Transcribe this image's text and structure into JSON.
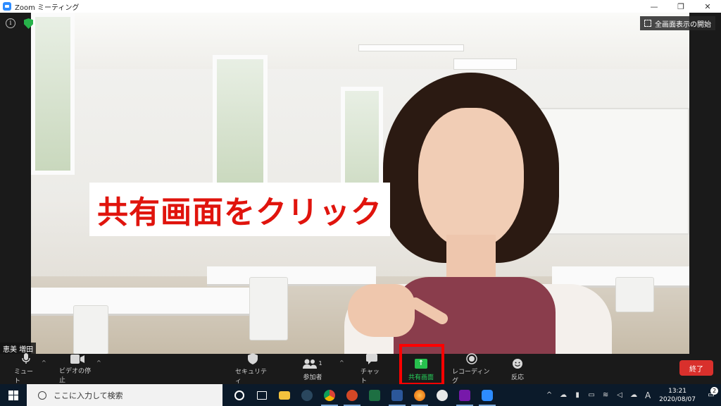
{
  "window": {
    "title": "Zoom ミーティング",
    "minimize_label": "—",
    "restore_label": "❐",
    "close_label": "✕"
  },
  "meeting": {
    "info_label": "i",
    "fullscreen_label": "全画面表示の開始",
    "participant_name": "恵美 増田",
    "caption": "共有画面をクリック"
  },
  "toolbar": {
    "mute_label": "ミュート",
    "video_label": "ビデオの停止",
    "security_label": "セキュリティ",
    "participants_label": "参加者",
    "participants_count": "1",
    "chat_label": "チャット",
    "share_label": "共有画面",
    "record_label": "レコーディング",
    "reactions_label": "反応",
    "end_label": "終了"
  },
  "taskbar": {
    "search_placeholder": "ここに入力して検索",
    "time": "13:21",
    "date": "2020/08/07",
    "ime_label": "A",
    "notification_count": "2",
    "apps": [
      "task-view",
      "file-explorer",
      "steam",
      "chrome",
      "powerpoint",
      "excel",
      "word",
      "firefox",
      "webcam",
      "onenote",
      "zoom"
    ]
  },
  "colors": {
    "accent_green": "#27c14e",
    "highlight_red": "#ff0000",
    "caption_red": "#e0140d",
    "end_button": "#d9302c"
  }
}
